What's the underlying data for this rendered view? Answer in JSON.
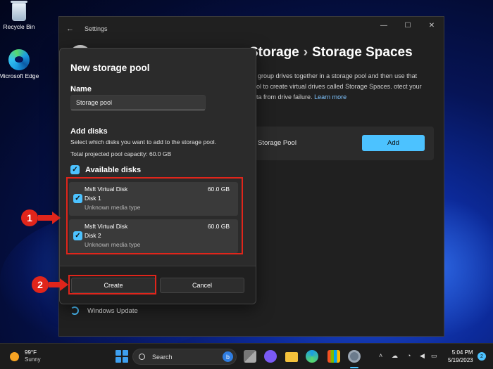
{
  "desktop": {
    "icons": [
      {
        "label": "Recycle Bin"
      },
      {
        "label": "Microsoft Edge"
      }
    ]
  },
  "settings": {
    "title": "Settings",
    "heading_parent": "Storage",
    "heading_sep": "›",
    "heading_current": "Storage Spaces",
    "description_part1": "es group drives together in a storage pool and then use that pool to create virtual drives called Storage Spaces. otect your data from drive failure.",
    "learn_more": "Learn more",
    "row_label": "Storage Pool",
    "add_label": "Add",
    "windows_update": "Windows Update"
  },
  "dialog": {
    "title": "New storage pool",
    "name_label": "Name",
    "name_value": "Storage pool",
    "add_disks_label": "Add disks",
    "add_disks_sub": "Select which disks you want to add to the storage pool.",
    "capacity": "Total projected pool capacity: 60.0 GB",
    "available_label": "Available disks",
    "disks": [
      {
        "name": "Msft Virtual Disk",
        "number": "Disk 1",
        "type": "Unknown media type",
        "size": "60.0 GB",
        "checked": true
      },
      {
        "name": "Msft Virtual Disk",
        "number": "Disk 2",
        "type": "Unknown media type",
        "size": "60.0 GB",
        "checked": true
      }
    ],
    "create_label": "Create",
    "cancel_label": "Cancel"
  },
  "annotations": {
    "step1": "1",
    "step2": "2",
    "highlight_color": "#e0251b"
  },
  "taskbar": {
    "weather_temp": "99°F",
    "weather_desc": "Sunny",
    "search_placeholder": "Search",
    "time": "5:04 PM",
    "date": "5/19/2023",
    "notification_count": "2"
  },
  "colors": {
    "accent": "#4cc2ff",
    "dialog_bg": "#2b2b2b",
    "window_bg": "#202020"
  }
}
